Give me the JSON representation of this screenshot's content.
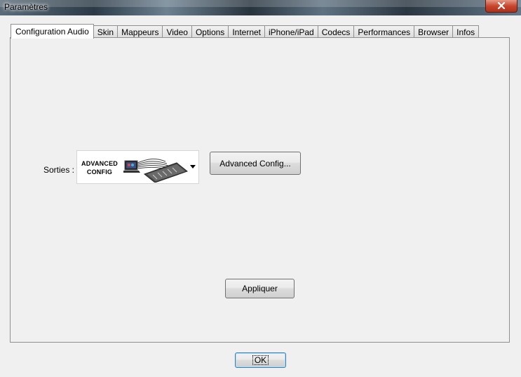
{
  "window": {
    "title": "Paramètres"
  },
  "tabs": [
    {
      "label": "Configuration Audio",
      "active": true
    },
    {
      "label": "Skin"
    },
    {
      "label": "Mappeurs"
    },
    {
      "label": "Video"
    },
    {
      "label": "Options"
    },
    {
      "label": "Internet"
    },
    {
      "label": "iPhone/iPad"
    },
    {
      "label": "Codecs"
    },
    {
      "label": "Performances"
    },
    {
      "label": "Browser"
    },
    {
      "label": "Infos"
    }
  ],
  "audio": {
    "outputs_label": "Sorties :",
    "outputs_selected_line1": "ADVANCED",
    "outputs_selected_line2": "CONFIG",
    "advanced_config_label": "Advanced Config...",
    "apply_label": "Appliquer"
  },
  "footer": {
    "ok_label": "OK"
  },
  "colors": {
    "dialog_bg": "#f0f0f0",
    "close_button": "#c7442b",
    "ok_focus": "#3c7fb1"
  }
}
